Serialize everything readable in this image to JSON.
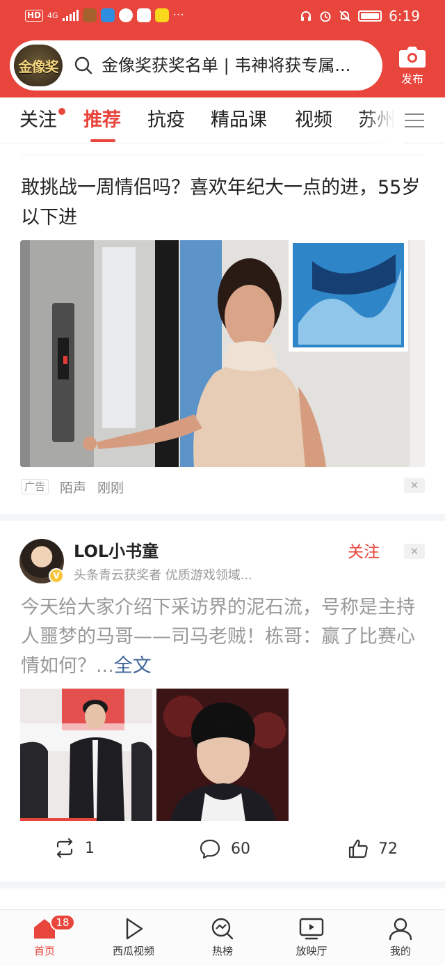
{
  "status_bar": {
    "network": "HD",
    "signal_label": "4G",
    "more": "···",
    "time": "6:19"
  },
  "search": {
    "logo_text": "金像奖",
    "query": "金像奖获奖名单 | 韦神将获专属..."
  },
  "publish": {
    "label": "发布"
  },
  "tabs": [
    {
      "label": "关注"
    },
    {
      "label": "推荐"
    },
    {
      "label": "抗疫"
    },
    {
      "label": "精品课"
    },
    {
      "label": "视频"
    },
    {
      "label": "苏州"
    }
  ],
  "ad_post": {
    "title": "敢挑战一周情侣吗？喜欢年纪大一点的进，55岁以下进",
    "ad_label": "广告",
    "source": "陌声",
    "time": "刚刚",
    "close": "✕"
  },
  "post": {
    "author": "LOL小书童",
    "author_desc": "头条青云获奖者 优质游戏领域...",
    "verify_mark": "V",
    "follow": "关注",
    "close": "✕",
    "text": "今天给大家介绍下采访界的泥石流，号称是主持人噩梦的马哥——司马老贼！栋哥：赢了比赛心情如何？...",
    "fulltext": "全文",
    "repost_count": "1",
    "comment_count": "60",
    "like_count": "72"
  },
  "bottom_nav": [
    {
      "label": "首页",
      "icon": "home-icon",
      "badge": "18"
    },
    {
      "label": "西瓜视频",
      "icon": "play-icon"
    },
    {
      "label": "热榜",
      "icon": "trending-icon"
    },
    {
      "label": "放映厅",
      "icon": "screen-icon"
    },
    {
      "label": "我的",
      "icon": "user-icon"
    }
  ],
  "colors": {
    "accent": "#e8453c",
    "link": "#406599",
    "muted": "#999999"
  }
}
